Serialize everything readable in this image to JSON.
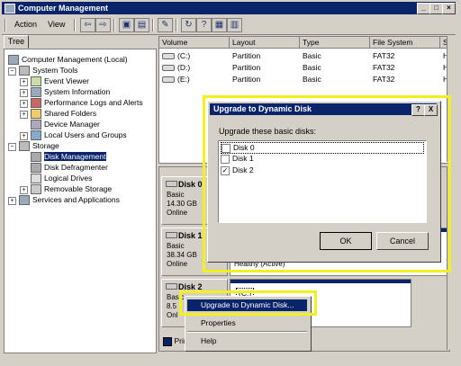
{
  "window": {
    "title": "Computer Management"
  },
  "menu": {
    "action": "Action",
    "view": "View"
  },
  "tree": {
    "tab_label": "Tree",
    "items": [
      {
        "label": "Computer Management (Local)"
      },
      {
        "label": "System Tools"
      },
      {
        "label": "Event Viewer"
      },
      {
        "label": "System Information"
      },
      {
        "label": "Performance Logs and Alerts"
      },
      {
        "label": "Shared Folders"
      },
      {
        "label": "Device Manager"
      },
      {
        "label": "Local Users and Groups"
      },
      {
        "label": "Storage"
      },
      {
        "label": "Disk Management"
      },
      {
        "label": "Disk Defragmenter"
      },
      {
        "label": "Logical Drives"
      },
      {
        "label": "Removable Storage"
      },
      {
        "label": "Services and Applications"
      }
    ]
  },
  "volumes": {
    "headers": [
      "Volume",
      "Layout",
      "Type",
      "File System",
      "St"
    ],
    "rows": [
      {
        "volume": "(C:)",
        "layout": "Partition",
        "type": "Basic",
        "fs": "FAT32",
        "status": "H"
      },
      {
        "volume": "(D:)",
        "layout": "Partition",
        "type": "Basic",
        "fs": "FAT32",
        "status": "H"
      },
      {
        "volume": "(E:)",
        "layout": "Partition",
        "type": "Basic",
        "fs": "FAT32",
        "status": "H"
      }
    ]
  },
  "disks": [
    {
      "name": "Disk 0",
      "type": "Basic",
      "size": "14.30 GB",
      "status": "Online"
    },
    {
      "name": "Disk 1",
      "type": "Basic",
      "size": "38.34 GB",
      "status": "Online",
      "volume_status": "Healthy (Active)"
    },
    {
      "name": "Disk 2",
      "type": "Basic",
      "size": "8.5",
      "status": "Onl",
      "volume": "(C:)"
    }
  ],
  "legend": {
    "primary": "Prim"
  },
  "dialog": {
    "title": "Upgrade to Dynamic Disk",
    "prompt": "Upgrade these basic disks:",
    "disks": [
      {
        "label": "Disk 0",
        "checked": false
      },
      {
        "label": "Disk 1",
        "checked": false
      },
      {
        "label": "Disk 2",
        "checked": true
      }
    ],
    "ok": "OK",
    "cancel": "Cancel",
    "help_button": "?",
    "close_button": "X"
  },
  "context_menu": {
    "items": [
      "Upgrade to Dynamic Disk...",
      "Properties",
      "Help"
    ]
  },
  "colors": {
    "titlebar": "#0a246a",
    "highlight": "#f4f01c",
    "face": "#d4d0c8"
  }
}
